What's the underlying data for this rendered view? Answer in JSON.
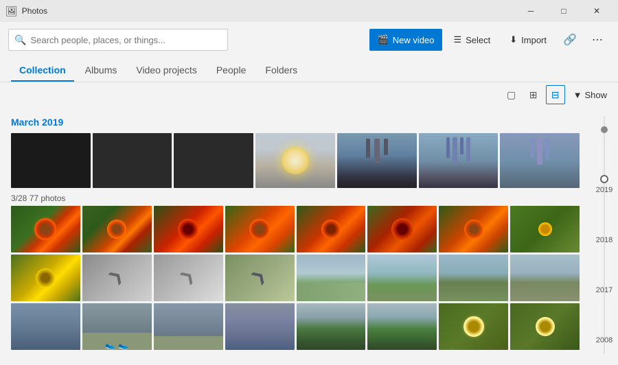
{
  "titleBar": {
    "title": "Photos",
    "controls": {
      "minimize": "─",
      "maximize": "□",
      "close": "✕"
    }
  },
  "search": {
    "placeholder": "Search people, places, or things..."
  },
  "toolbar": {
    "newVideoLabel": "New video",
    "selectLabel": "Select",
    "importLabel": "Import",
    "moreLabel": "⋯"
  },
  "nav": {
    "tabs": [
      {
        "id": "collection",
        "label": "Collection",
        "active": true
      },
      {
        "id": "albums",
        "label": "Albums",
        "active": false
      },
      {
        "id": "video-projects",
        "label": "Video projects",
        "active": false
      },
      {
        "id": "people",
        "label": "People",
        "active": false
      },
      {
        "id": "folders",
        "label": "Folders",
        "active": false
      }
    ]
  },
  "viewOptions": {
    "showLabel": "Show"
  },
  "sections": [
    {
      "date": "March 2019",
      "groups": [
        {
          "label": "",
          "thumbs": [
            "dark",
            "dark",
            "dark",
            "sky",
            "city",
            "city2",
            "city3"
          ]
        },
        {
          "label": "3/28   77 photos",
          "rows": [
            [
              "flower-red1",
              "flower-red2",
              "flower-red3",
              "flower-orange1",
              "flower-orange2",
              "flower-orange3",
              "flower-orange4",
              "flower-yellow1"
            ],
            [
              "flower-yellow2",
              "arrow1",
              "arrow2",
              "arrow3",
              "park1",
              "park2",
              "park3",
              "park4"
            ],
            [
              "building1",
              "grass1",
              "grass2",
              "building2",
              "tree1",
              "tree2",
              "daisy1",
              "daisy2"
            ]
          ]
        }
      ]
    }
  ],
  "timeline": {
    "years": [
      "2019",
      "2018",
      "2017",
      "2008"
    ]
  },
  "colors": {
    "accent": "#0078d4",
    "titleBarBg": "#e8e8e8",
    "tabActiveBorder": "#0078d4"
  }
}
